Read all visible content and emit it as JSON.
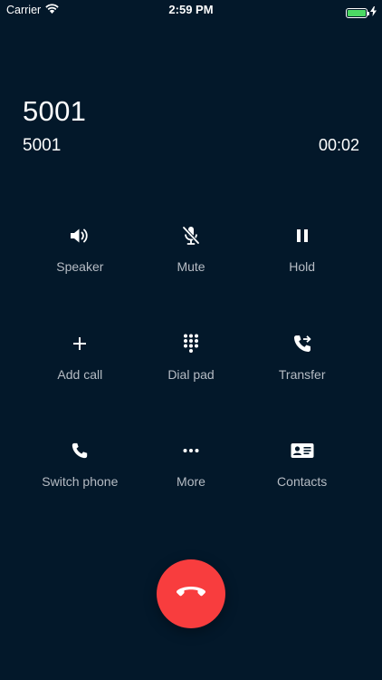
{
  "status_bar": {
    "carrier": "Carrier",
    "time": "2:59 PM",
    "battery_color": "#4cd964"
  },
  "call": {
    "name": "5001",
    "number": "5001",
    "duration": "00:02"
  },
  "actions": [
    {
      "label": "Speaker",
      "icon": "speaker-icon"
    },
    {
      "label": "Mute",
      "icon": "microphone-off-icon"
    },
    {
      "label": "Hold",
      "icon": "pause-icon"
    },
    {
      "label": "Add call",
      "icon": "plus-icon"
    },
    {
      "label": "Dial pad",
      "icon": "dialpad-icon"
    },
    {
      "label": "Transfer",
      "icon": "phone-forward-icon"
    },
    {
      "label": "Switch phone",
      "icon": "phone-icon"
    },
    {
      "label": "More",
      "icon": "more-icon"
    },
    {
      "label": "Contacts",
      "icon": "contact-card-icon"
    }
  ],
  "end_call": {
    "icon": "hang-up-icon",
    "color": "#f83d3e"
  },
  "theme": {
    "background": "#03182a",
    "label_color": "#b6bcc4"
  }
}
